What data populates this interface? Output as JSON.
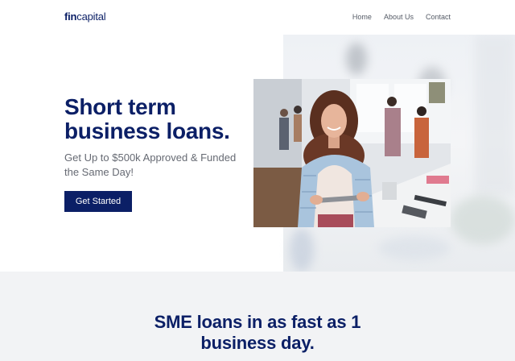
{
  "nav": {
    "logo_bold": "fin",
    "logo_rest": "capital",
    "links": [
      "Home",
      "About Us",
      "Contact"
    ]
  },
  "hero": {
    "title": "Short term business loans.",
    "subtitle": "Get Up to $500k Approved & Funded the Same Day!",
    "cta_label": "Get Started",
    "image": "office-woman-with-tablet-photo"
  },
  "section2": {
    "title": "SME loans in as fast as 1 business day."
  },
  "colors": {
    "brand": "#0b1f66",
    "muted_text": "#666a73",
    "section_bg": "#f2f3f5"
  }
}
